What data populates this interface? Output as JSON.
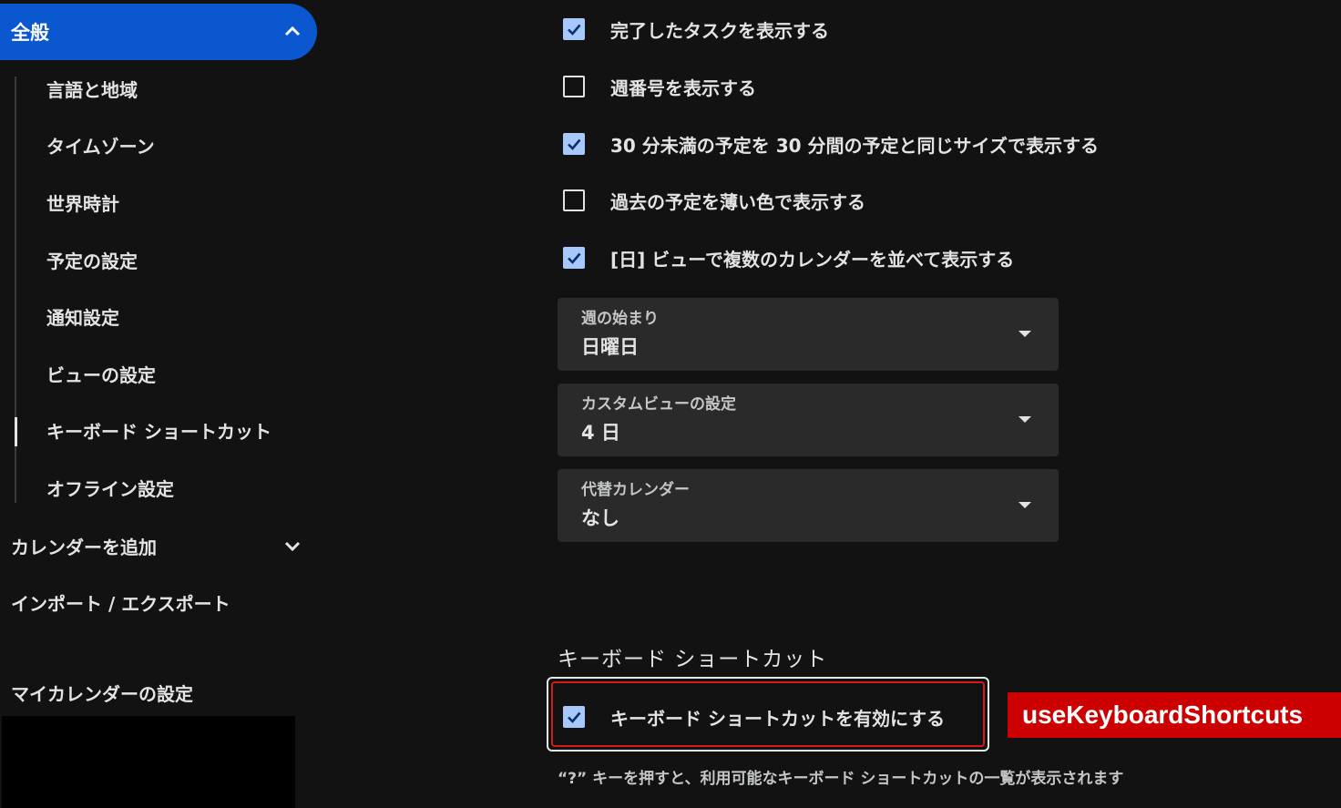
{
  "sidebar": {
    "general": {
      "label": "全般",
      "icon": "chevron-up-icon"
    },
    "sub_items": [
      {
        "label": "言語と地域"
      },
      {
        "label": "タイムゾーン"
      },
      {
        "label": "世界時計"
      },
      {
        "label": "予定の設定"
      },
      {
        "label": "通知設定"
      },
      {
        "label": "ビューの設定"
      },
      {
        "label": "キーボード ショートカット",
        "active": true
      },
      {
        "label": "オフライン設定"
      }
    ],
    "add_calendar": {
      "label": "カレンダーを追加",
      "icon": "chevron-down-icon"
    },
    "import_export": {
      "label": "インポート / エクスポート"
    },
    "my_calendars_title": "マイカレンダーの設定"
  },
  "view_options": {
    "checkboxes": [
      {
        "label": "完了したタスクを表示する",
        "checked": true
      },
      {
        "label": "週番号を表示する",
        "checked": false
      },
      {
        "label": "30 分未満の予定を 30 分間の予定と同じサイズで表示する",
        "checked": true
      },
      {
        "label": "過去の予定を薄い色で表示する",
        "checked": false
      },
      {
        "label": "[日] ビューで複数のカレンダーを並べて表示する",
        "checked": true
      }
    ],
    "selects": [
      {
        "label": "週の始まり",
        "value": "日曜日"
      },
      {
        "label": "カスタムビューの設定",
        "value": "4 日"
      },
      {
        "label": "代替カレンダー",
        "value": "なし"
      }
    ]
  },
  "keyboard": {
    "section_title": "キーボード ショートカット",
    "enable_label": "キーボード ショートカットを有効にする",
    "enable_checked": true,
    "hint": "“?” キーを押すと、利用可能なキーボード ショートカットの一覧が表示されます",
    "annotation": "useKeyboardShortcuts"
  },
  "colors": {
    "accent": "#0b57d0",
    "checkbox_checked": "#a8c7fa",
    "annotation_red": "#cc0000",
    "background": "#121212"
  }
}
